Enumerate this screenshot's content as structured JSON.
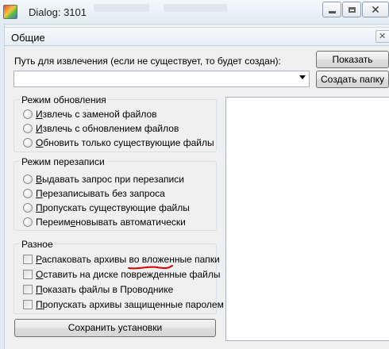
{
  "window": {
    "title": "Dialog: 3101"
  },
  "tab": {
    "title": "Общие"
  },
  "path": {
    "label": "Путь для извлечения (если не существует, то будет создан):",
    "value": ""
  },
  "buttons": {
    "show": "Показать",
    "new_folder": "Создать папку",
    "save": "Сохранить установки"
  },
  "update_mode": {
    "title": "Режим обновления",
    "options": [
      {
        "pre": "",
        "u": "И",
        "post": "звлечь с заменой файлов"
      },
      {
        "pre": "",
        "u": "И",
        "post": "звлечь с обновлением файлов"
      },
      {
        "pre": "",
        "u": "О",
        "post": "бновить только существующие файлы"
      }
    ]
  },
  "overwrite_mode": {
    "title": "Режим перезаписи",
    "options": [
      {
        "pre": "",
        "u": "В",
        "post": "ыдавать запрос при перезаписи"
      },
      {
        "pre": "",
        "u": "П",
        "post": "ерезаписывать без запроса"
      },
      {
        "pre": "",
        "u": "П",
        "post": "ропускать существующие файлы"
      },
      {
        "pre": "Переим",
        "u": "е",
        "post": "новывать автоматически"
      }
    ]
  },
  "misc": {
    "title": "Разное",
    "options": [
      {
        "pre": "",
        "u": "Р",
        "post": "аспаковать архивы во вложенные папки"
      },
      {
        "pre": "",
        "u": "О",
        "post": "ставить на диске поврежденные файлы"
      },
      {
        "pre": "",
        "u": "П",
        "post": "оказать файлы в Проводнике"
      },
      {
        "pre": "",
        "u": "П",
        "post": "ропускать архивы защищенные паролем"
      }
    ]
  },
  "annotation": {
    "color": "#d40000"
  }
}
